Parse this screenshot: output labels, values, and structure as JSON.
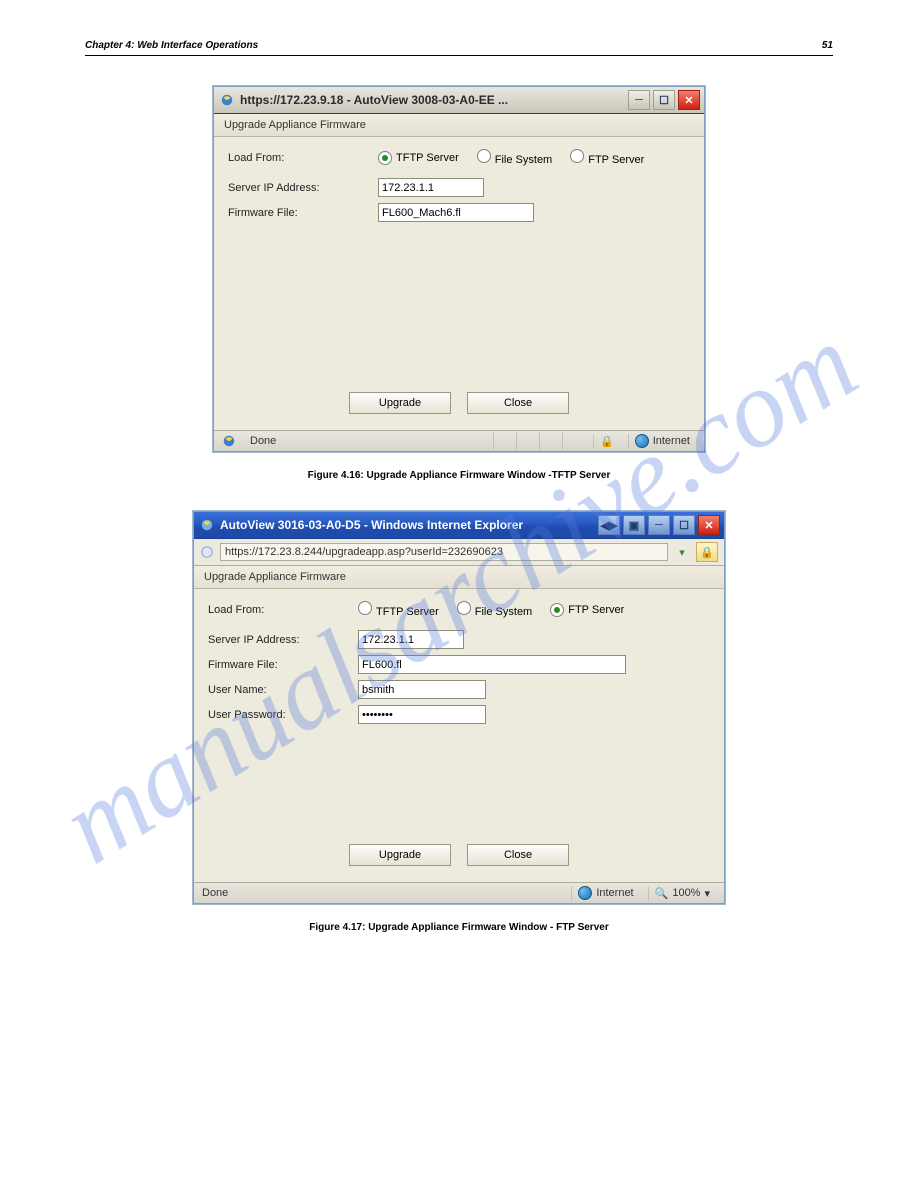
{
  "page": {
    "header_left": "Chapter 4: Web Interface Operations",
    "header_right": "51",
    "watermark": "manualsarchive.com"
  },
  "dialog_a": {
    "title": "https://172.23.9.18 - AutoView 3008-03-A0-EE ...",
    "panel_title": "Upgrade Appliance Firmware",
    "load_from_label": "Load From:",
    "options": {
      "tftp": "TFTP Server",
      "filesys": "File System",
      "ftp": "FTP Server"
    },
    "fields": {
      "server_ip_label": "Server IP Address:",
      "server_ip_value": "172.23.1.1",
      "firmware_label": "Firmware File:",
      "firmware_value": "FL600_Mach6.fl"
    },
    "buttons": {
      "upgrade": "Upgrade",
      "close": "Close"
    },
    "status": {
      "done": "Done",
      "zone": "Internet"
    },
    "figcap": "Figure 4.16: Upgrade Appliance Firmware Window -TFTP Server"
  },
  "dialog_b": {
    "title": "AutoView 3016-03-A0-D5 - Windows Internet Explorer",
    "url": "https://172.23.8.244/upgradeapp.asp?userId=232690623",
    "panel_title": "Upgrade Appliance Firmware",
    "load_from_label": "Load From:",
    "options": {
      "tftp": "TFTP Server",
      "filesys": "File System",
      "ftp": "FTP Server"
    },
    "fields": {
      "server_ip_label": "Server IP Address:",
      "server_ip_value": "172.23.1.1",
      "firmware_label": "Firmware File:",
      "firmware_value": "FL600.fl",
      "user_name_label": "User Name:",
      "user_name_value": "bsmith",
      "user_pass_label": "User Password:",
      "user_pass_value": "••••••••"
    },
    "buttons": {
      "upgrade": "Upgrade",
      "close": "Close"
    },
    "status": {
      "done": "Done",
      "zone": "Internet",
      "zoom": "100%"
    },
    "figcap": "Figure 4.17: Upgrade Appliance Firmware Window - FTP Server"
  }
}
